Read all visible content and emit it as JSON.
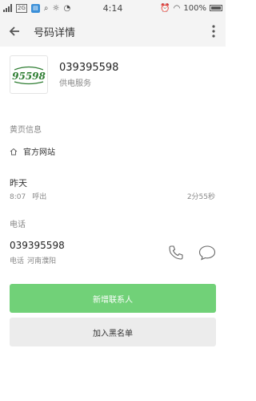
{
  "statusbar": {
    "carrier_box": "2G",
    "time": "4:14",
    "battery": "100%"
  },
  "toolbar": {
    "title": "号码详情"
  },
  "contact": {
    "logo_text": "95598",
    "number": "039395598",
    "name": "供电服务"
  },
  "yellow_page": {
    "header": "黄页信息",
    "link_label": "官方网站"
  },
  "call_record": {
    "date": "昨天",
    "time": "8:07",
    "type": "呼出",
    "duration": "2分55秒"
  },
  "phone": {
    "header": "电话",
    "number": "039395598",
    "label": "电话",
    "location": "河南濮阳"
  },
  "buttons": {
    "add_contact": "新增联系人",
    "blacklist": "加入黑名单"
  },
  "colors": {
    "accent": "#71d178",
    "logo_green": "#2e7d32"
  }
}
